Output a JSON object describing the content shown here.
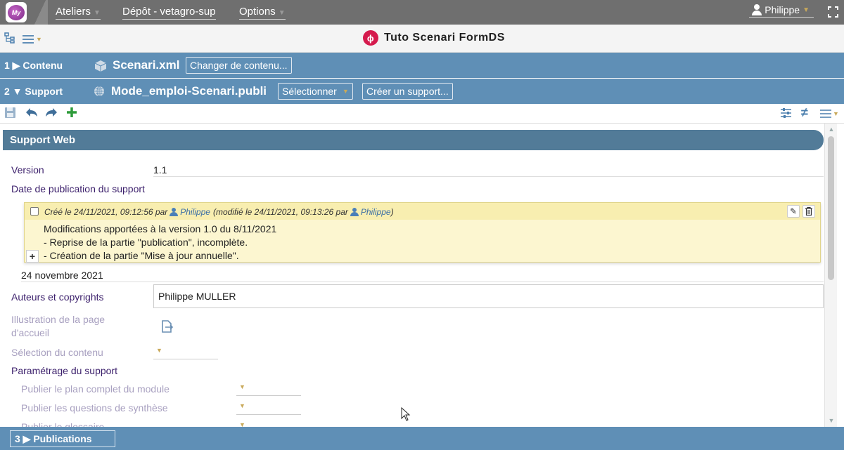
{
  "topbar": {
    "logo_text": "My",
    "menus": [
      {
        "label": "Ateliers",
        "has_caret": true
      },
      {
        "label": "Dépôt - vetagro-sup",
        "has_caret": false
      },
      {
        "label": "Options",
        "has_caret": true
      }
    ],
    "user": "Philippe",
    "user_icon": "user-icon",
    "fullscreen_icon": "fullscreen-icon"
  },
  "titlebar": {
    "title": "Tuto Scenari FormDS",
    "title_icon": "scenari-phi-icon",
    "left_icons": [
      "tree-view-icon",
      "menu-icon"
    ]
  },
  "steps": {
    "contenu": {
      "label": "1 ▶ Contenu",
      "item": "Scenari.xml",
      "icon": "cube-icon",
      "button": "Changer de contenu..."
    },
    "support": {
      "label": "2 ▼ Support",
      "item": "Mode_emploi-Scenari.publi",
      "icon": "globe-icon",
      "select": "Sélectionner",
      "button": "Créer un support..."
    },
    "publications": {
      "label": "3 ▶ Publications"
    }
  },
  "toolbar": {
    "left": [
      "save-icon",
      "undo-icon",
      "redo-icon",
      "add-icon"
    ],
    "right": [
      "filter-icon",
      "not-equal-icon",
      "menu-icon"
    ]
  },
  "form": {
    "section_title": "Support Web",
    "version_label": "Version",
    "version_value": "1.1",
    "date_label": "Date de publication du support",
    "date_value": "24 novembre 2021",
    "comment": {
      "created_prefix": "Créé le 24/11/2021, 09:12:56 par",
      "created_by": "Philippe",
      "modified_prefix": "(modifié le 24/11/2021, 09:13:26 par",
      "modified_by": "Philippe",
      "modified_suffix": ")",
      "lines": [
        "Modifications apportées à la version 1.0 du 8/11/2021",
        "- Reprise de la partie \"publication\", incomplète.",
        "- Création de la partie \"Mise à jour annuelle\"."
      ]
    },
    "authors_label": "Auteurs et copyrights",
    "authors_value": "Philippe MULLER",
    "illustration_label": "Illustration de la page d'accueil",
    "selection_label": "Sélection du contenu",
    "params_label": "Paramétrage du support",
    "params": [
      "Publier le plan complet du module",
      "Publier les questions de synthèse",
      "Publier le glossaire"
    ]
  },
  "colors": {
    "topbar": "#6f6f6f",
    "step_bar": "#5f8fb6",
    "section_head": "#527b98",
    "comment_bg": "#fcf6d0",
    "label": "#3b1f6b",
    "accent_red": "#d51a4d"
  }
}
